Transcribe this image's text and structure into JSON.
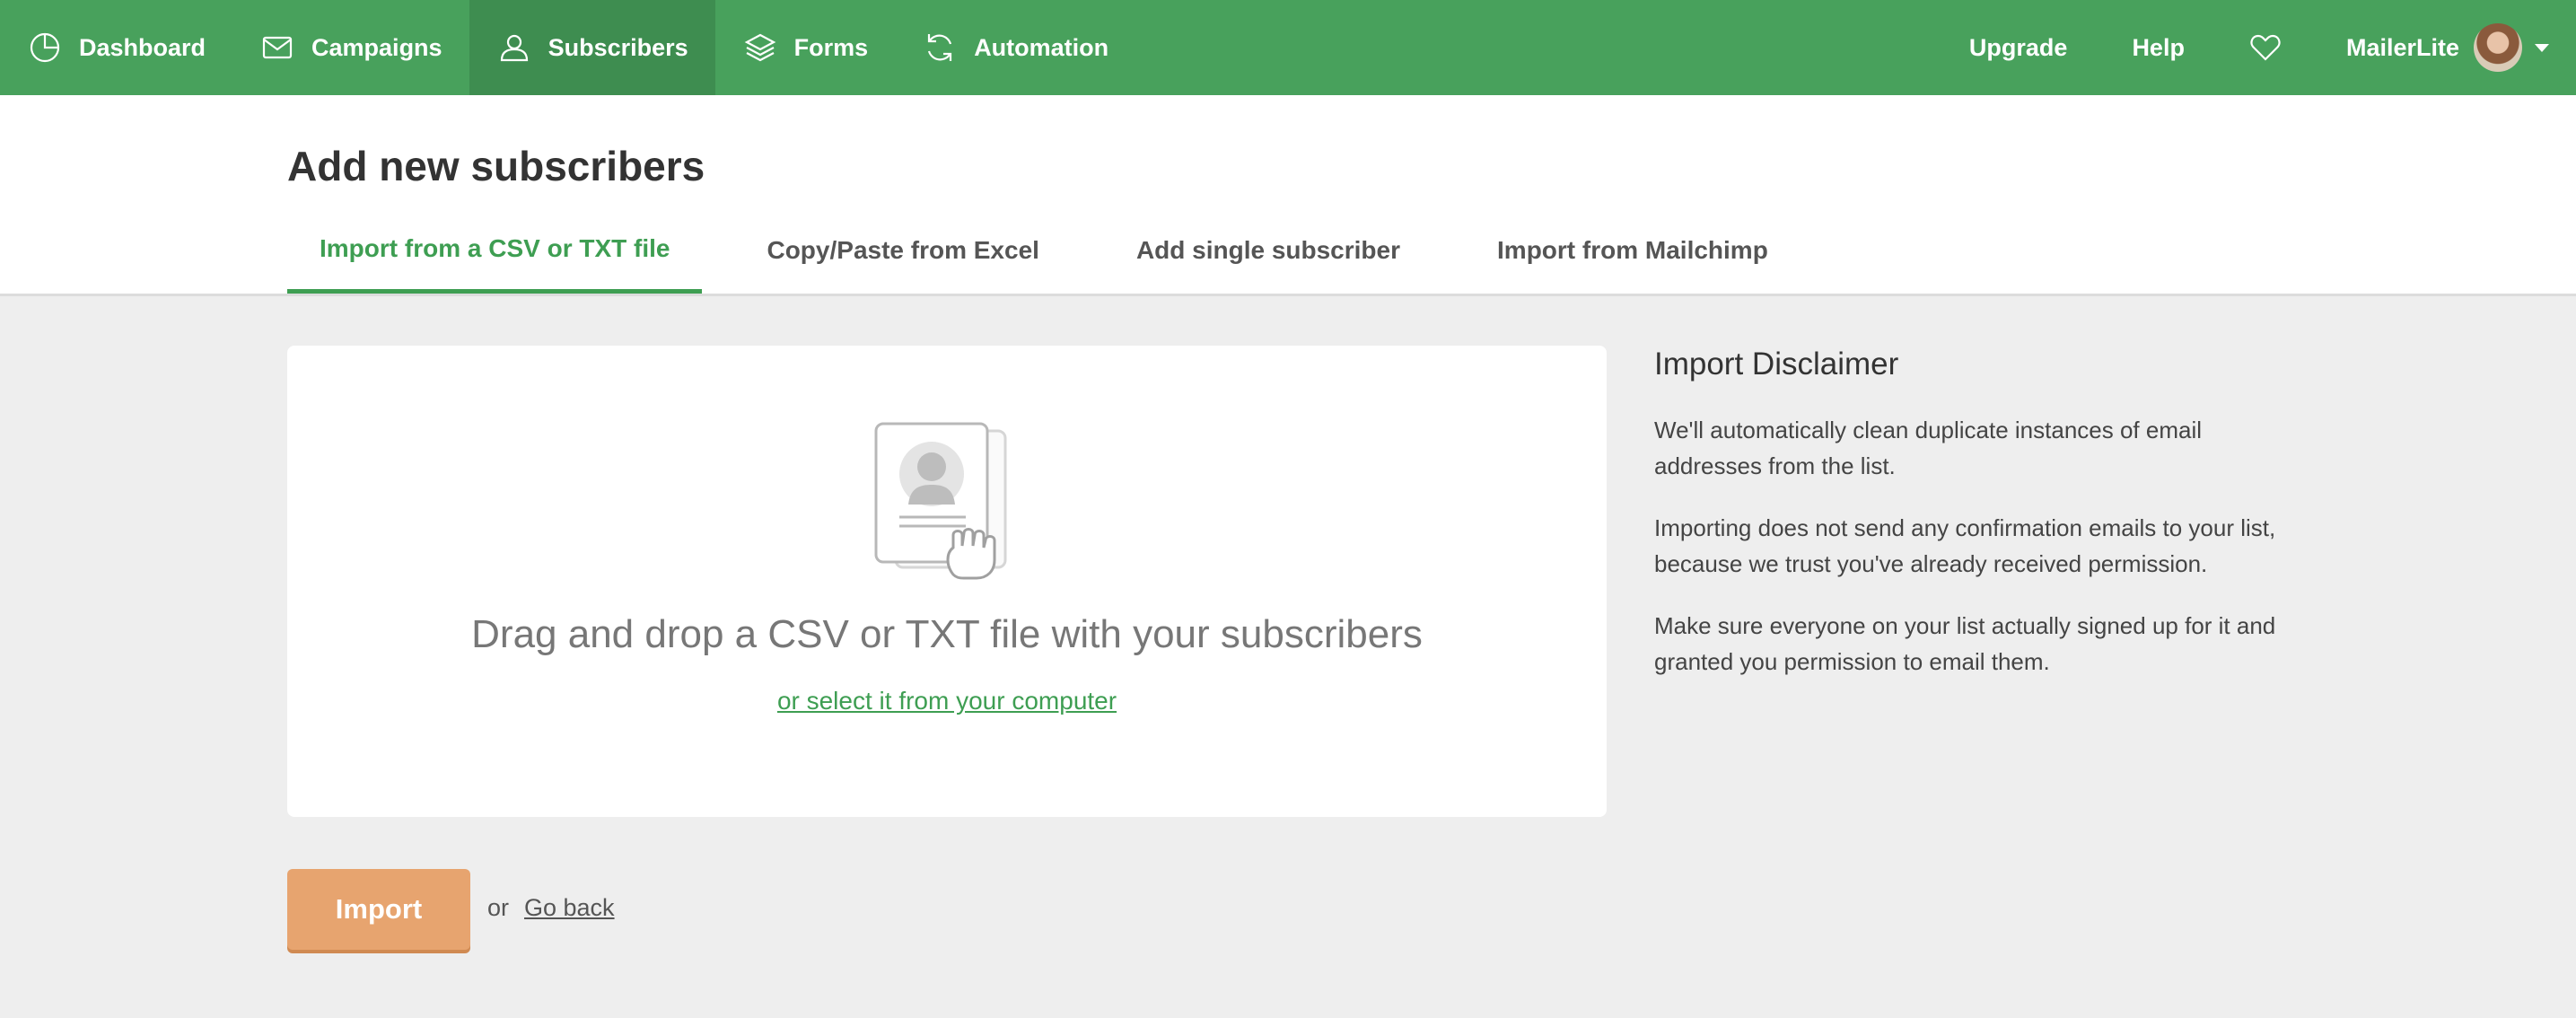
{
  "nav": {
    "items": [
      {
        "label": "Dashboard",
        "icon": "pie-chart-icon"
      },
      {
        "label": "Campaigns",
        "icon": "envelope-icon"
      },
      {
        "label": "Subscribers",
        "icon": "user-icon",
        "active": true
      },
      {
        "label": "Forms",
        "icon": "layers-icon"
      },
      {
        "label": "Automation",
        "icon": "refresh-icon"
      }
    ],
    "right": {
      "upgrade": "Upgrade",
      "help": "Help",
      "favorites_icon": "heart-icon",
      "account_name": "MailerLite"
    }
  },
  "page": {
    "title": "Add new subscribers",
    "tabs": [
      {
        "label": "Import from a CSV or TXT file",
        "active": true
      },
      {
        "label": "Copy/Paste from Excel"
      },
      {
        "label": "Add single subscriber"
      },
      {
        "label": "Import from Mailchimp"
      }
    ]
  },
  "dropzone": {
    "icon": "contact-card-drag-icon",
    "text": "Drag and drop a CSV or TXT file with your subscribers",
    "link": "or select it from your computer"
  },
  "disclaimer": {
    "title": "Import Disclaimer",
    "paragraphs": [
      "We'll automatically clean duplicate instances of email addresses from the list.",
      "Importing does not send any confirmation emails to your list, because we trust you've already received permission.",
      "Make sure everyone on your list actually signed up for it and granted you permission to email them."
    ]
  },
  "actions": {
    "import_label": "Import",
    "or_text": "or",
    "back_label": "Go back"
  },
  "colors": {
    "brand_green": "#48a15c",
    "active_nav": "#3e8d50",
    "accent_green": "#3e9e52",
    "import_orange": "#e7a46f",
    "background": "#eeeeee"
  }
}
